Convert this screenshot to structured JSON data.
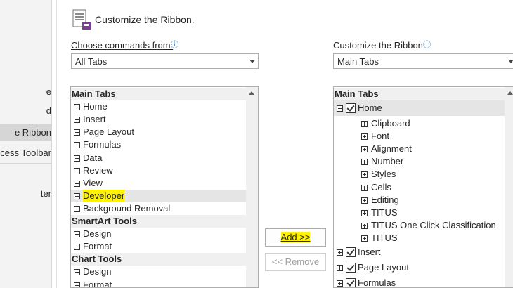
{
  "left_nav": {
    "items": [
      {
        "label": "e"
      },
      {
        "label": "d"
      },
      {
        "label": "e Ribbon",
        "selected": true
      },
      {
        "label": "cess Toolbar"
      },
      {
        "label": "ter"
      }
    ]
  },
  "header": {
    "title": "Customize the Ribbon.",
    "icon": "ribbon-settings-icon"
  },
  "left_panel": {
    "label": "Choose commands from:",
    "info_icon": "info-icon",
    "dropdown_value": "All Tabs",
    "items": [
      {
        "type": "group",
        "label": "Main Tabs"
      },
      {
        "type": "item",
        "label": "Home"
      },
      {
        "type": "item",
        "label": "Insert"
      },
      {
        "type": "item",
        "label": "Page Layout"
      },
      {
        "type": "item",
        "label": "Formulas"
      },
      {
        "type": "item",
        "label": "Data"
      },
      {
        "type": "item",
        "label": "Review"
      },
      {
        "type": "item",
        "label": "View"
      },
      {
        "type": "item",
        "label": "Developer",
        "highlighted": true
      },
      {
        "type": "item",
        "label": "Background Removal"
      },
      {
        "type": "group",
        "label": "SmartArt Tools"
      },
      {
        "type": "item",
        "label": "Design"
      },
      {
        "type": "item",
        "label": "Format"
      },
      {
        "type": "group",
        "label": "Chart Tools"
      },
      {
        "type": "item",
        "label": "Design"
      },
      {
        "type": "item",
        "label": "Format"
      }
    ]
  },
  "buttons": {
    "add_label": "Add >>",
    "remove_label": "<< Remove"
  },
  "right_panel": {
    "label": "Customize the Ribbon:",
    "info_icon": "info-icon",
    "dropdown_value": "Main Tabs",
    "items": [
      {
        "type": "group",
        "label": "Main Tabs"
      },
      {
        "type": "tab",
        "label": "Home",
        "expanded": true,
        "checked": true,
        "selected": true
      },
      {
        "type": "child",
        "label": "Clipboard"
      },
      {
        "type": "child",
        "label": "Font"
      },
      {
        "type": "child",
        "label": "Alignment"
      },
      {
        "type": "child",
        "label": "Number"
      },
      {
        "type": "child",
        "label": "Styles"
      },
      {
        "type": "child",
        "label": "Cells"
      },
      {
        "type": "child",
        "label": "Editing"
      },
      {
        "type": "child",
        "label": "TITUS"
      },
      {
        "type": "child",
        "label": "TITUS One Click Classification"
      },
      {
        "type": "child",
        "label": "TITUS"
      },
      {
        "type": "tab",
        "label": "Insert",
        "checked": true
      },
      {
        "type": "tab",
        "label": "Page Layout",
        "checked": true
      },
      {
        "type": "tab",
        "label": "Formulas",
        "checked": true
      }
    ]
  },
  "colors": {
    "highlight": "#fff200",
    "selected_row": "#e5e5e5",
    "nav_selected": "#d6d6d6"
  }
}
